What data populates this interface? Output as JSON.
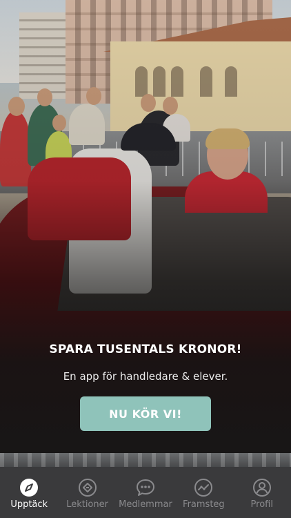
{
  "promo": {
    "headline": "SPARA TUSENTALS KRONOR!",
    "subline": "En app för handledare & elever.",
    "cta_label": "NU KÖR VI!"
  },
  "tabbar": {
    "active_index": 0,
    "tabs": [
      {
        "label": "Upptäck",
        "icon": "compass-icon"
      },
      {
        "label": "Lektioner",
        "icon": "lessons-icon"
      },
      {
        "label": "Medlemmar",
        "icon": "chat-bubble-icon"
      },
      {
        "label": "Framsteg",
        "icon": "progress-chart-icon"
      },
      {
        "label": "Profil",
        "icon": "profile-icon"
      }
    ]
  },
  "colors": {
    "cta_background": "#8fc3ba",
    "tabbar_background": "#3a3a3c",
    "tab_active": "#ffffff",
    "tab_inactive": "#8a8a8d"
  }
}
